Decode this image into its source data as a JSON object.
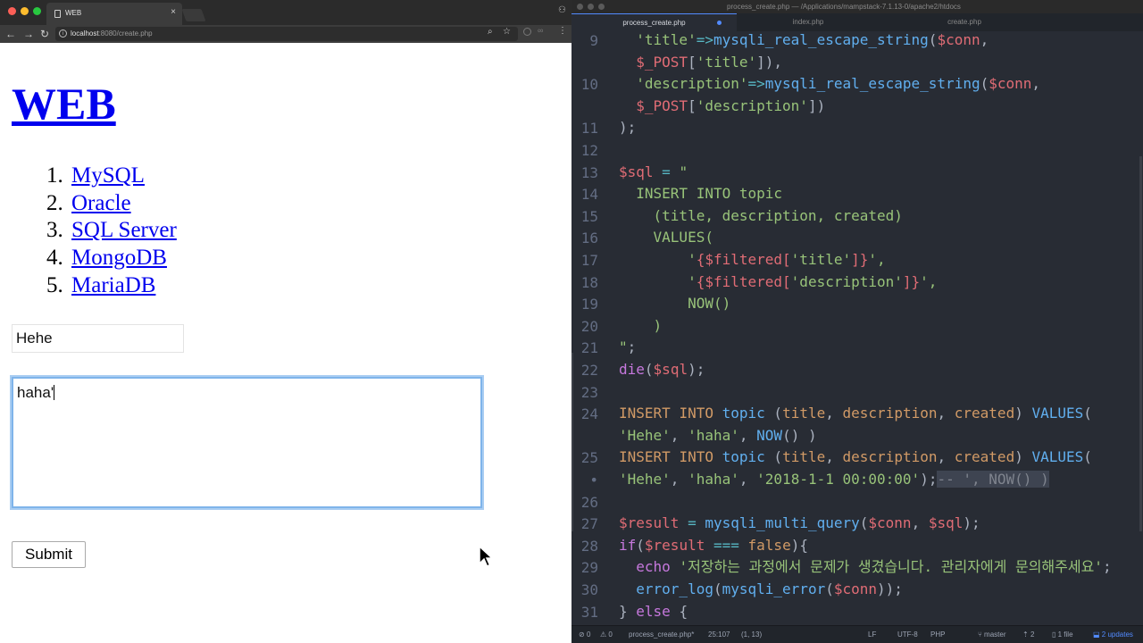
{
  "browser": {
    "tab_title": "WEB",
    "tab_close": "×",
    "url_host": "localhost",
    "url_rest": ":8080/create.php",
    "nav_back": "←",
    "nav_forward": "→",
    "nav_reload": "↻",
    "icons": [
      "back-icon",
      "forward-icon",
      "reload-icon",
      "info-icon",
      "zoom-icon",
      "star-icon",
      "menu-icon"
    ]
  },
  "page": {
    "heading": "WEB",
    "topics": [
      {
        "num": "1.",
        "label": "MySQL"
      },
      {
        "num": "2.",
        "label": "Oracle"
      },
      {
        "num": "3.",
        "label": "SQL Server"
      },
      {
        "num": "4.",
        "label": "MongoDB"
      },
      {
        "num": "5.",
        "label": "MariaDB"
      }
    ],
    "title_value": "Hehe",
    "description_value": "haha'",
    "submit_label": "Submit"
  },
  "editor": {
    "window_title": "process_create.php — /Applications/mampstack-7.1.13-0/apache2/htdocs",
    "tabs": [
      "process_create.php",
      "index.php",
      "create.php"
    ],
    "line_numbers": [
      "9",
      "",
      "10",
      "",
      "11",
      "12",
      "13",
      "14",
      "15",
      "16",
      "17",
      "18",
      "19",
      "20",
      "21",
      "22",
      "23",
      "24",
      "",
      "25",
      "•",
      "26",
      "27",
      "28",
      "29",
      "30",
      "31"
    ],
    "code_lines": [
      "  'title'=>mysqli_real_escape_string($conn,",
      "  $_POST['title']),",
      "  'description'=>mysqli_real_escape_string($conn,",
      "  $_POST['description'])",
      ");",
      "",
      "$sql = \"",
      "  INSERT INTO topic",
      "    (title, description, created)",
      "    VALUES(",
      "        '{$filtered['title']}',",
      "        '{$filtered['description']}',",
      "        NOW()",
      "    )",
      "\";",
      "die($sql);",
      "",
      "INSERT INTO topic (title, description, created) VALUES(",
      "'Hehe', 'haha', NOW() )",
      "INSERT INTO topic (title, description, created) VALUES(",
      "'Hehe', 'haha', '2018-1-1 00:00:00');-- ', NOW() )",
      "",
      "$result = mysqli_multi_query($conn, $sql);",
      "if($result === false){",
      "  echo '저장하는 과정에서 문제가 생겼습니다. 관리자에게 문의해주세요';",
      "  error_log(mysqli_error($conn));",
      "} else {"
    ]
  },
  "statusbar": {
    "errors": "0",
    "warnings": "0",
    "filename": "process_create.php*",
    "cursor": "25:107",
    "selection": "(1, 13)",
    "line_ending": "LF",
    "encoding": "UTF-8",
    "grammar": "PHP",
    "branch": "master",
    "push": "2",
    "files": "1 file",
    "updates": "2 updates"
  }
}
